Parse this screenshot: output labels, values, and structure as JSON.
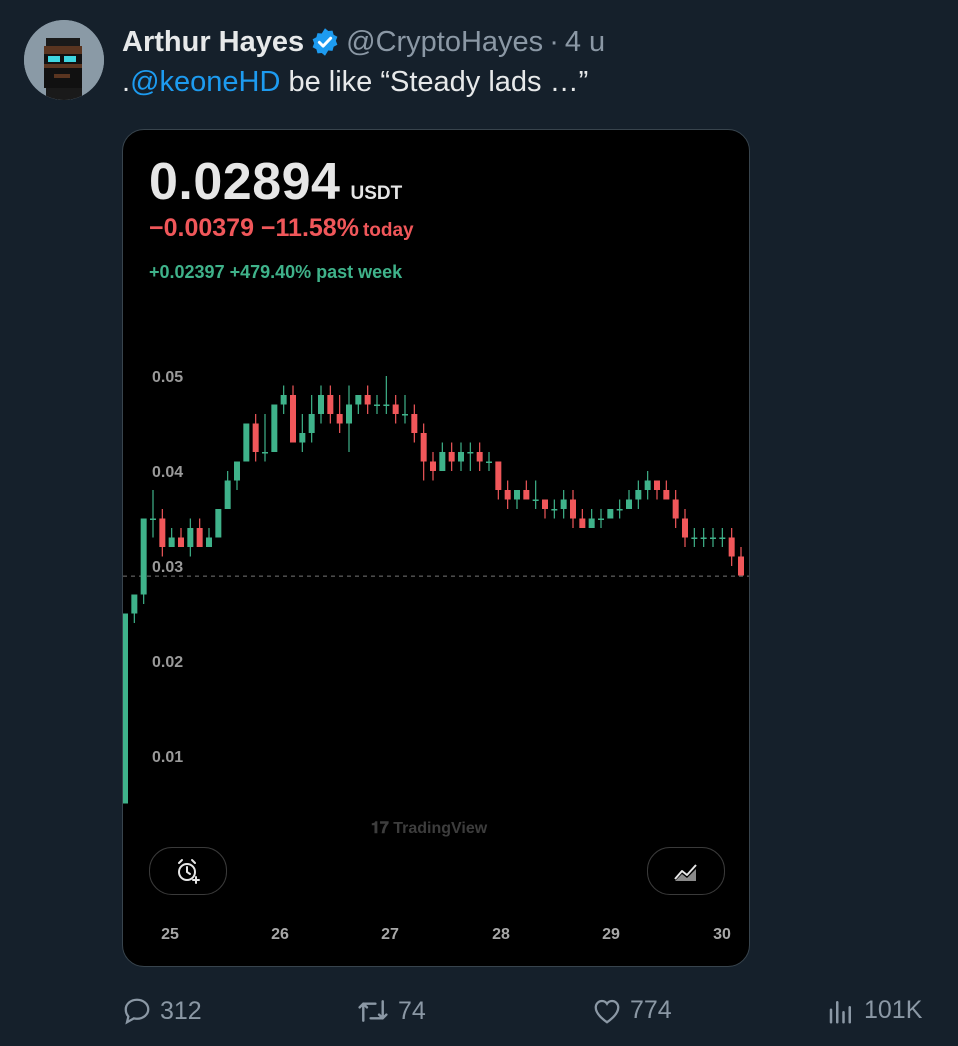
{
  "tweet": {
    "author_name": "Arthur Hayes",
    "handle": "@CryptoHayes",
    "separator": "·",
    "time": "4 u",
    "text_prefix": ".",
    "mention": "@keoneHD",
    "text_rest": " be like “Steady lads …”"
  },
  "card": {
    "price": "0.02894",
    "unit": "USDT",
    "change_today": "−0.00379 −11.58%",
    "change_today_label": "today",
    "change_week": "+0.02397 +479.40% past week",
    "watermark": "TradingView",
    "alert_button_icon": "alarm-plus-icon",
    "chart_type_button_icon": "area-chart-icon"
  },
  "actions": {
    "replies": "312",
    "retweets": "74",
    "likes": "774",
    "views": "101K"
  },
  "colors": {
    "background": "#15202b",
    "mention": "#1d9bf0",
    "up": "#3fb28a",
    "down": "#f0575a",
    "muted": "#8b98a5"
  },
  "chart_data": {
    "type": "candlestick",
    "y_ticks": [
      "0.05",
      "0.04",
      "0.03",
      "0.02",
      "0.01"
    ],
    "y_tick_values": [
      0.05,
      0.04,
      0.03,
      0.02,
      0.01
    ],
    "x_ticks": [
      "25",
      "26",
      "27",
      "28",
      "29",
      "30"
    ],
    "ylim": [
      0.0,
      0.06
    ],
    "last_price": 0.02894,
    "grid": false,
    "candles": [
      [
        0.005,
        0.025,
        0.005,
        0.025
      ],
      [
        0.025,
        0.027,
        0.024,
        0.027
      ],
      [
        0.027,
        0.035,
        0.026,
        0.035
      ],
      [
        0.035,
        0.038,
        0.033,
        0.035
      ],
      [
        0.035,
        0.036,
        0.031,
        0.032
      ],
      [
        0.032,
        0.034,
        0.032,
        0.033
      ],
      [
        0.033,
        0.034,
        0.032,
        0.032
      ],
      [
        0.032,
        0.035,
        0.031,
        0.034
      ],
      [
        0.034,
        0.035,
        0.032,
        0.032
      ],
      [
        0.032,
        0.034,
        0.032,
        0.033
      ],
      [
        0.033,
        0.036,
        0.033,
        0.036
      ],
      [
        0.036,
        0.04,
        0.036,
        0.039
      ],
      [
        0.039,
        0.041,
        0.038,
        0.041
      ],
      [
        0.041,
        0.045,
        0.041,
        0.045
      ],
      [
        0.045,
        0.046,
        0.041,
        0.042
      ],
      [
        0.042,
        0.046,
        0.041,
        0.042
      ],
      [
        0.042,
        0.047,
        0.042,
        0.047
      ],
      [
        0.047,
        0.049,
        0.046,
        0.048
      ],
      [
        0.048,
        0.049,
        0.043,
        0.043
      ],
      [
        0.043,
        0.046,
        0.042,
        0.044
      ],
      [
        0.044,
        0.048,
        0.043,
        0.046
      ],
      [
        0.046,
        0.049,
        0.045,
        0.048
      ],
      [
        0.048,
        0.049,
        0.045,
        0.046
      ],
      [
        0.046,
        0.048,
        0.044,
        0.045
      ],
      [
        0.045,
        0.049,
        0.042,
        0.047
      ],
      [
        0.047,
        0.048,
        0.046,
        0.048
      ],
      [
        0.048,
        0.049,
        0.046,
        0.047
      ],
      [
        0.047,
        0.048,
        0.046,
        0.047
      ],
      [
        0.047,
        0.05,
        0.046,
        0.047
      ],
      [
        0.047,
        0.048,
        0.045,
        0.046
      ],
      [
        0.046,
        0.048,
        0.045,
        0.046
      ],
      [
        0.046,
        0.047,
        0.043,
        0.044
      ],
      [
        0.044,
        0.045,
        0.039,
        0.041
      ],
      [
        0.041,
        0.042,
        0.039,
        0.04
      ],
      [
        0.04,
        0.043,
        0.04,
        0.042
      ],
      [
        0.042,
        0.043,
        0.04,
        0.041
      ],
      [
        0.041,
        0.043,
        0.04,
        0.042
      ],
      [
        0.042,
        0.043,
        0.04,
        0.042
      ],
      [
        0.042,
        0.043,
        0.04,
        0.041
      ],
      [
        0.041,
        0.042,
        0.04,
        0.041
      ],
      [
        0.041,
        0.041,
        0.037,
        0.038
      ],
      [
        0.038,
        0.039,
        0.036,
        0.037
      ],
      [
        0.037,
        0.038,
        0.036,
        0.038
      ],
      [
        0.038,
        0.039,
        0.037,
        0.037
      ],
      [
        0.037,
        0.039,
        0.036,
        0.037
      ],
      [
        0.037,
        0.037,
        0.035,
        0.036
      ],
      [
        0.036,
        0.037,
        0.035,
        0.036
      ],
      [
        0.036,
        0.038,
        0.035,
        0.037
      ],
      [
        0.037,
        0.038,
        0.034,
        0.035
      ],
      [
        0.035,
        0.036,
        0.034,
        0.034
      ],
      [
        0.034,
        0.036,
        0.034,
        0.035
      ],
      [
        0.035,
        0.036,
        0.034,
        0.035
      ],
      [
        0.035,
        0.036,
        0.035,
        0.036
      ],
      [
        0.036,
        0.037,
        0.035,
        0.036
      ],
      [
        0.036,
        0.038,
        0.036,
        0.037
      ],
      [
        0.037,
        0.039,
        0.036,
        0.038
      ],
      [
        0.038,
        0.04,
        0.037,
        0.039
      ],
      [
        0.039,
        0.039,
        0.037,
        0.038
      ],
      [
        0.038,
        0.039,
        0.037,
        0.037
      ],
      [
        0.037,
        0.038,
        0.034,
        0.035
      ],
      [
        0.035,
        0.036,
        0.032,
        0.033
      ],
      [
        0.033,
        0.034,
        0.032,
        0.033
      ],
      [
        0.033,
        0.034,
        0.032,
        0.033
      ],
      [
        0.033,
        0.034,
        0.032,
        0.033
      ],
      [
        0.033,
        0.034,
        0.032,
        0.033
      ],
      [
        0.033,
        0.034,
        0.03,
        0.031
      ],
      [
        0.031,
        0.032,
        0.029,
        0.029
      ]
    ]
  }
}
